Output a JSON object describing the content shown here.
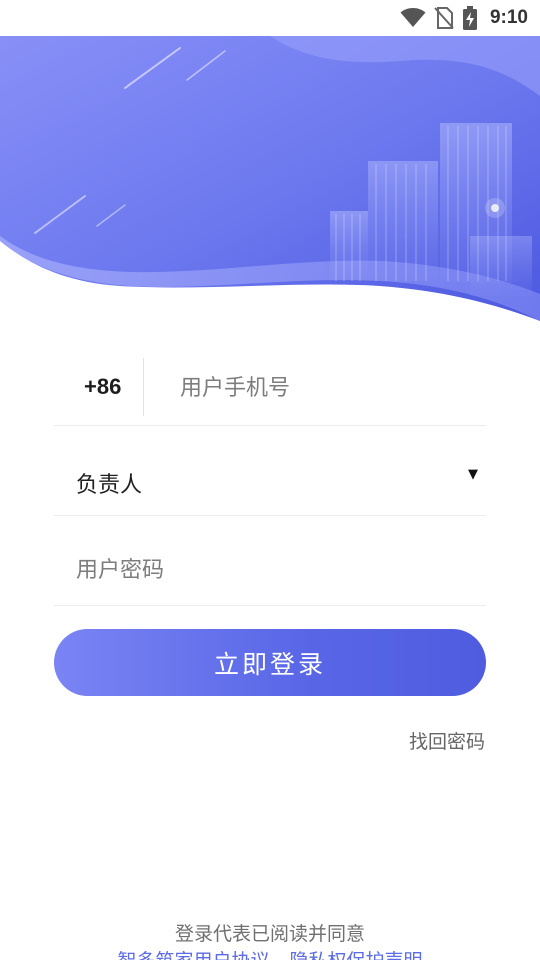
{
  "status_bar": {
    "time": "9:10",
    "icons": [
      "wifi-icon",
      "no-sim-icon",
      "battery-charging-icon"
    ]
  },
  "colors": {
    "accent": "#5f6ce8",
    "banner_light": "#8e98f8",
    "banner_dark": "#5561e2",
    "link": "#5d6be6"
  },
  "login": {
    "country_code": "+86",
    "phone_placeholder": "用户手机号",
    "role_value": "负责人",
    "role_caret": "▼",
    "password_placeholder": "用户密码",
    "submit_label": "立即登录",
    "forgot_password": "找回密码"
  },
  "footer": {
    "agreement_prefix": "登录代表已阅读并同意",
    "user_agreement": "智多筑家用户协议",
    "privacy_policy": "隐私权保护声明"
  }
}
